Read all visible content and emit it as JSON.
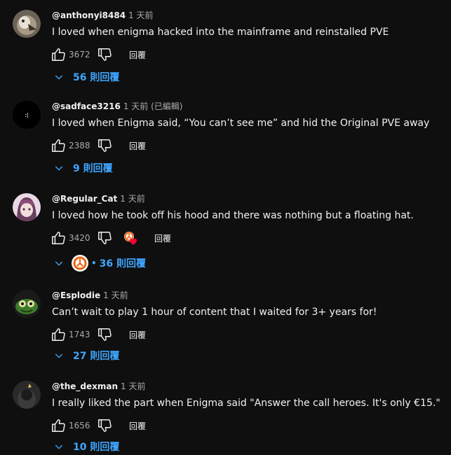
{
  "comments": [
    {
      "handle": "@anthonyi8484",
      "time": "1 天前",
      "text": "I loved when enigma hacked into the mainframe and reinstalled PVE",
      "likes": "3672",
      "reply_label": "回覆",
      "replies_label": "56 則回覆"
    },
    {
      "handle": "@sadface3216",
      "time": "1 天前 (已編輯)",
      "text": "I loved when Enigma said, “You can’t see me” and hid the Original PVE away",
      "likes": "2388",
      "reply_label": "回覆",
      "replies_label": "9 則回覆",
      "avatar_text": ":("
    },
    {
      "handle": "@Regular_Cat",
      "time": "1 天前",
      "text": "I loved how he took off his hood and there was nothing but a floating hat.",
      "likes": "3420",
      "reply_label": "回覆",
      "replies_label": "36 則回覆",
      "creator_dot": "•"
    },
    {
      "handle": "@Esplodie",
      "time": "1 天前",
      "text": "Can’t wait to play 1 hour of content that I waited for 3+ years for!",
      "likes": "1743",
      "reply_label": "回覆",
      "replies_label": "27 則回覆"
    },
    {
      "handle": "@the_dexman",
      "time": "1 天前",
      "text": "I really liked the part when Enigma said \"Answer the call heroes. It's only €15.\"",
      "likes": "1656",
      "reply_label": "回覆",
      "replies_label": "10 則回覆"
    }
  ],
  "icons": {
    "like": "thumbs-up-icon",
    "dislike": "thumbs-down-icon",
    "expand": "chevron-down-icon",
    "creator_heart": "creator-heart-icon"
  },
  "colors": {
    "background": "#0f0f0f",
    "text": "#f1f1f1",
    "secondary_text": "#aaaaaa",
    "link": "#3ea6ff",
    "heart": "#ff0033"
  }
}
